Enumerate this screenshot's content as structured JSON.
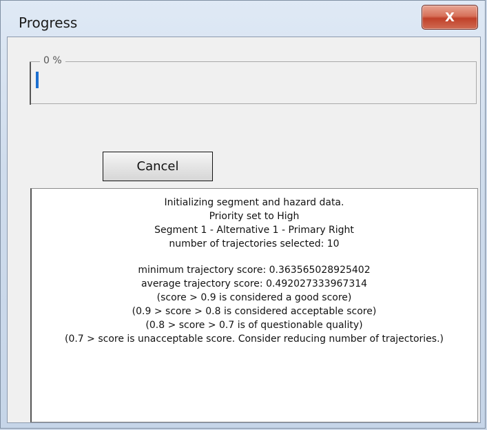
{
  "window": {
    "title": "Progress",
    "close_glyph": "X"
  },
  "progress": {
    "caption": "0 %",
    "value_percent": 0
  },
  "cancel_label": "Cancel",
  "log": {
    "block1": [
      "Initializing segment and hazard data.",
      "Priority set to High",
      "Segment 1 - Alternative 1 - Primary Right",
      "number of trajectories selected: 10"
    ],
    "block2": [
      "minimum trajectory score: 0.363565028925402",
      "average trajectory score: 0.492027333967314",
      "(score > 0.9 is considered a good score)",
      "(0.9 > score > 0.8 is considered acceptable score)",
      "(0.8 > score > 0.7 is of questionable quality)",
      "(0.7 > score is unacceptable score. Consider reducing number of trajectories.)"
    ]
  },
  "colors": {
    "progress_fill": "#1c6fd0",
    "close_button": "#c0412a"
  }
}
